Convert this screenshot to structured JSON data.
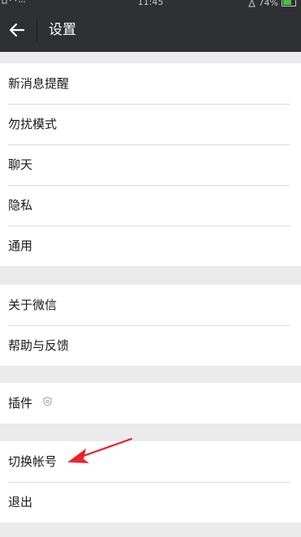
{
  "status_bar": {
    "time": "11:45",
    "battery": "74%",
    "battery_level": 0.74
  },
  "titlebar": {
    "title": "设置"
  },
  "groups": [
    {
      "items": [
        {
          "label": "新消息提醒"
        },
        {
          "label": "勿扰模式"
        },
        {
          "label": "聊天"
        },
        {
          "label": "隐私"
        },
        {
          "label": "通用"
        }
      ]
    },
    {
      "items": [
        {
          "label": "关于微信"
        },
        {
          "label": "帮助与反馈"
        }
      ]
    },
    {
      "items": [
        {
          "label": "插件"
        }
      ]
    },
    {
      "items": [
        {
          "label": "切换帐号"
        },
        {
          "label": "退出"
        }
      ]
    }
  ],
  "colors": {
    "titlebar": "#2f3033",
    "annotation_arrow": "#e8212c",
    "page_background": "#ebebeb"
  },
  "icons": {
    "back": "arrow-left-icon",
    "plugin": "shield-icon",
    "annotation": "red-arrow-icon"
  }
}
